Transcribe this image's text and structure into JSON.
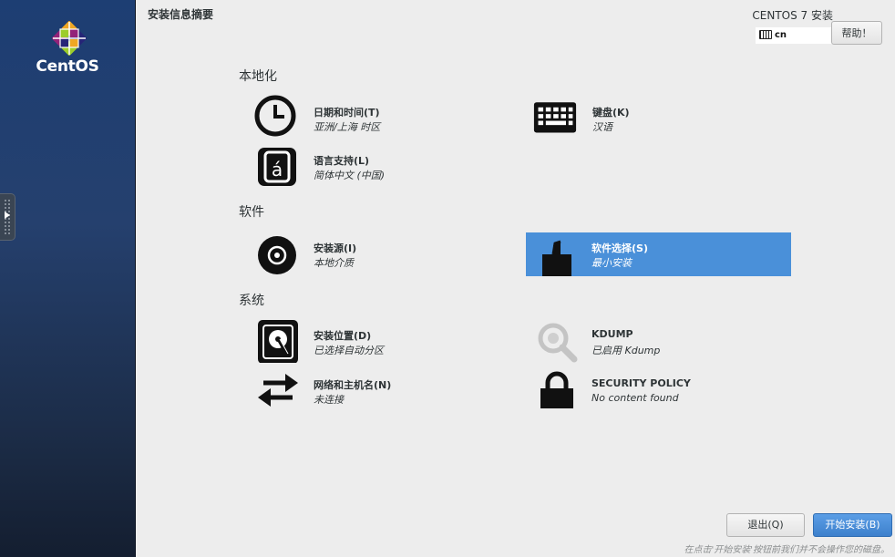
{
  "sidebar": {
    "logo_text": "CentOS"
  },
  "header": {
    "page_title": "安装信息摘要",
    "product_title": "CENTOS 7 安装",
    "keyboard_layout": "cn",
    "help_label": "帮助！"
  },
  "categories": {
    "localization": "本地化",
    "software": "软件",
    "system": "系统"
  },
  "spokes": {
    "datetime": {
      "title": "日期和时间(T)",
      "status": "亚洲/上海 时区"
    },
    "keyboard": {
      "title": "键盘(K)",
      "status": "汉语"
    },
    "language": {
      "title": "语言支持(L)",
      "status": "简体中文 (中国)"
    },
    "source": {
      "title": "安装源(I)",
      "status": "本地介质"
    },
    "software_selection": {
      "title": "软件选择(S)",
      "status": "最小安装"
    },
    "destination": {
      "title": "安装位置(D)",
      "status": "已选择自动分区"
    },
    "kdump": {
      "title": "KDUMP",
      "status": "已启用 Kdump"
    },
    "network": {
      "title": "网络和主机名(N)",
      "status": "未连接"
    },
    "security": {
      "title": "SECURITY POLICY",
      "status": "No content found"
    }
  },
  "footer": {
    "quit_label": "退出(Q)",
    "begin_label": "开始安装(B)",
    "note": "在点击'开始安装'按钮前我们并不会操作您的磁盘。"
  },
  "colors": {
    "accent": "#4a90d9",
    "sidebar": "#25406e",
    "background": "#ededed"
  },
  "icons": [
    "clock-icon",
    "keyboard-icon",
    "language-icon",
    "optical-disc-icon",
    "package-icon",
    "hard-disk-icon",
    "search-icon",
    "network-arrows-icon",
    "lock-icon"
  ]
}
